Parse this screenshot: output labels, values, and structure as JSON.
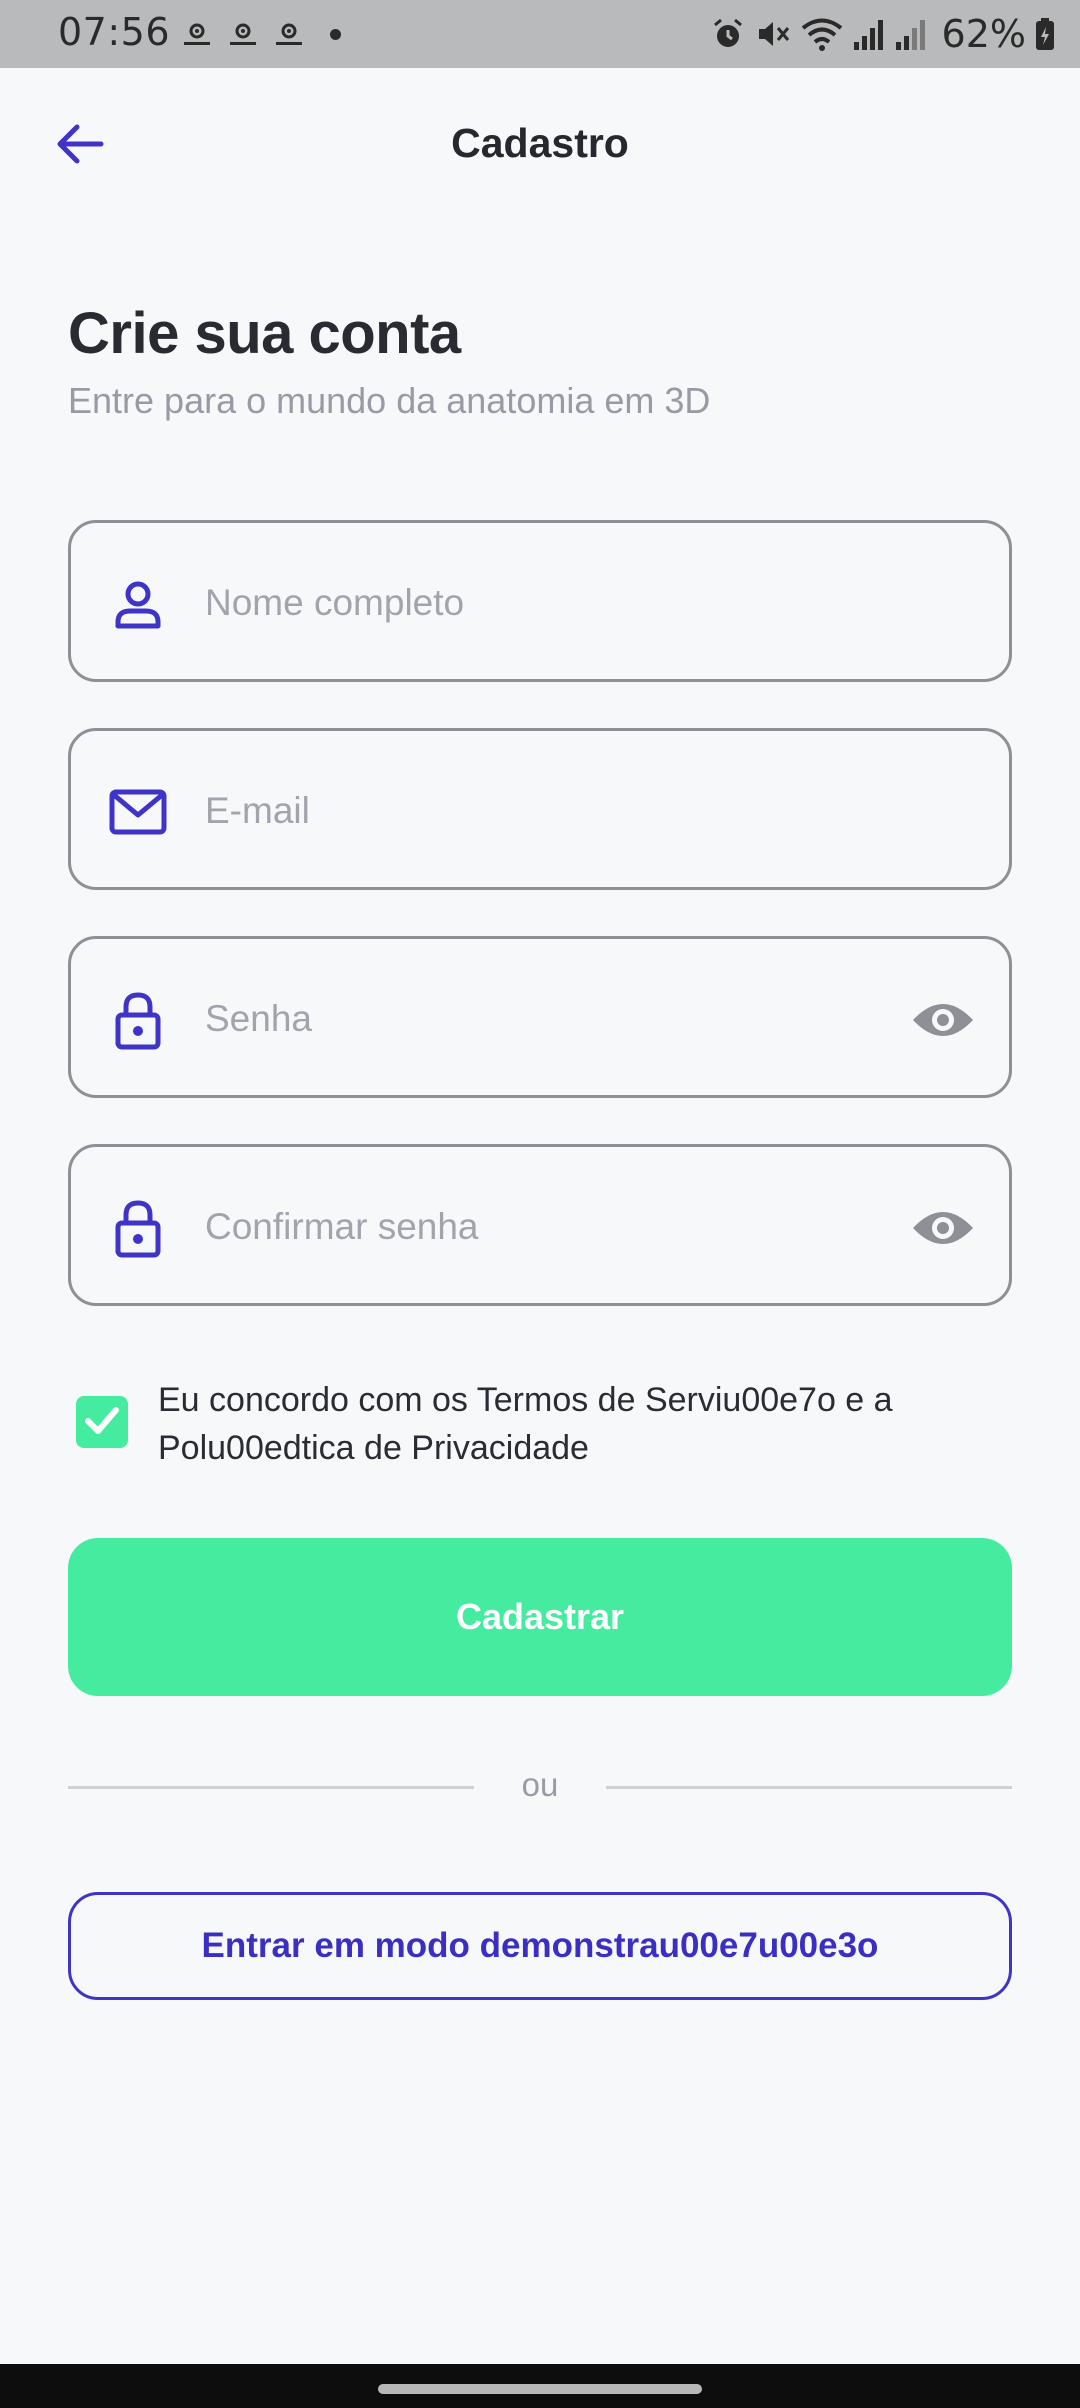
{
  "status_bar": {
    "time": "07:56",
    "notification_icons": [
      "gear-icon",
      "gear-icon",
      "gear-icon"
    ],
    "right_icons": [
      "alarm-icon",
      "mute-icon",
      "wifi-icon",
      "signal-icon",
      "signal-icon",
      "battery-icon"
    ],
    "battery": "62%"
  },
  "app_bar": {
    "back_icon": "arrow-left-icon",
    "title": "Cadastro"
  },
  "header": {
    "title": "Crie sua conta",
    "subtitle": "Entre para o mundo da anatomia em 3D"
  },
  "form": {
    "name": {
      "placeholder": "Nome completo",
      "value": "",
      "icon": "person-icon"
    },
    "email": {
      "placeholder": "E-mail",
      "value": "",
      "icon": "mail-icon"
    },
    "password": {
      "placeholder": "Senha",
      "value": "",
      "icon": "lock-icon",
      "toggle_icon": "eye-icon"
    },
    "confirm_password": {
      "placeholder": "Confirmar senha",
      "value": "",
      "icon": "lock-icon",
      "toggle_icon": "eye-icon"
    }
  },
  "terms": {
    "checked": true,
    "line1": "Eu concordo com os Termos de Serviu00e7o e a",
    "line2": "Polu00edtica de Privacidade"
  },
  "actions": {
    "register_label": "Cadastrar",
    "divider_label": "ou",
    "demo_label": "Entrar em modo demonstrau00e7u00e3o"
  },
  "colors": {
    "accent": "#3f33c8",
    "primary_button": "#45eb9e",
    "background": "#f7f8fa"
  }
}
